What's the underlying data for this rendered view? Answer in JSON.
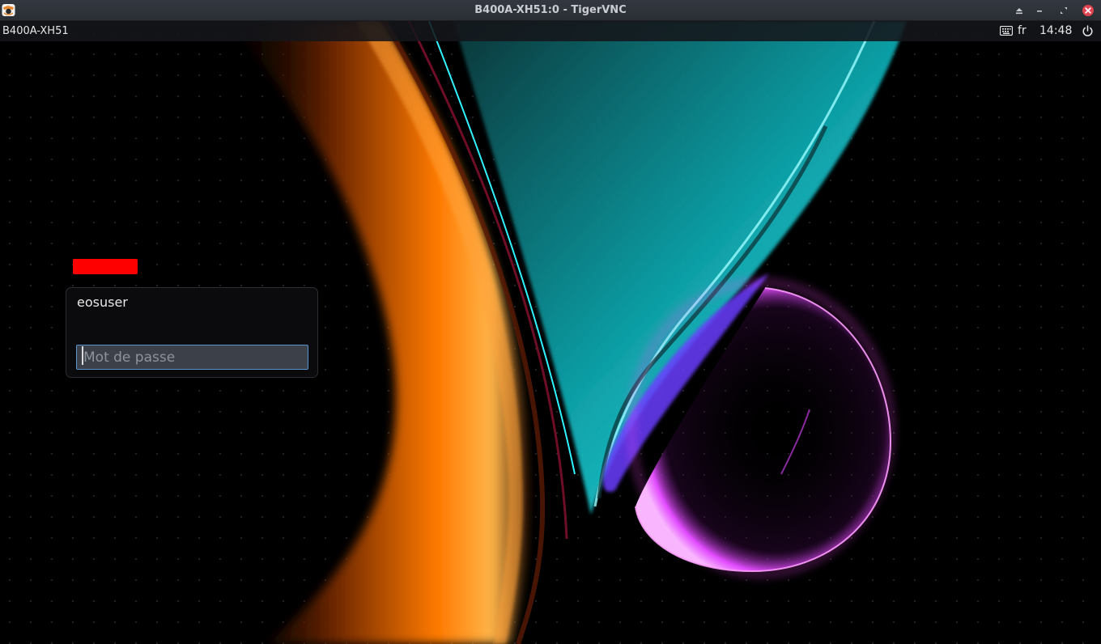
{
  "window": {
    "title": "B400A-XH51:0 - TigerVNC",
    "app_icon": "tigervnc-icon",
    "controls": [
      "shade-icon",
      "minimize-icon",
      "maximize-icon",
      "close-icon"
    ]
  },
  "panel": {
    "hostname": "B400A-XH51",
    "keyboard_icon": "keyboard-icon",
    "keyboard_layout": "fr",
    "clock": "14:48",
    "power_icon": "power-icon"
  },
  "login": {
    "username": "eosuser",
    "password_placeholder": "Mot de passe",
    "password_value": "",
    "badge_color": "#ff0000"
  },
  "colors": {
    "accent_focus": "#5b93d1",
    "close_button": "#e0434f",
    "wallpaper_orange": "#ff7a00",
    "wallpaper_cyan": "#14e6ee",
    "wallpaper_magenta": "#e24cff"
  }
}
